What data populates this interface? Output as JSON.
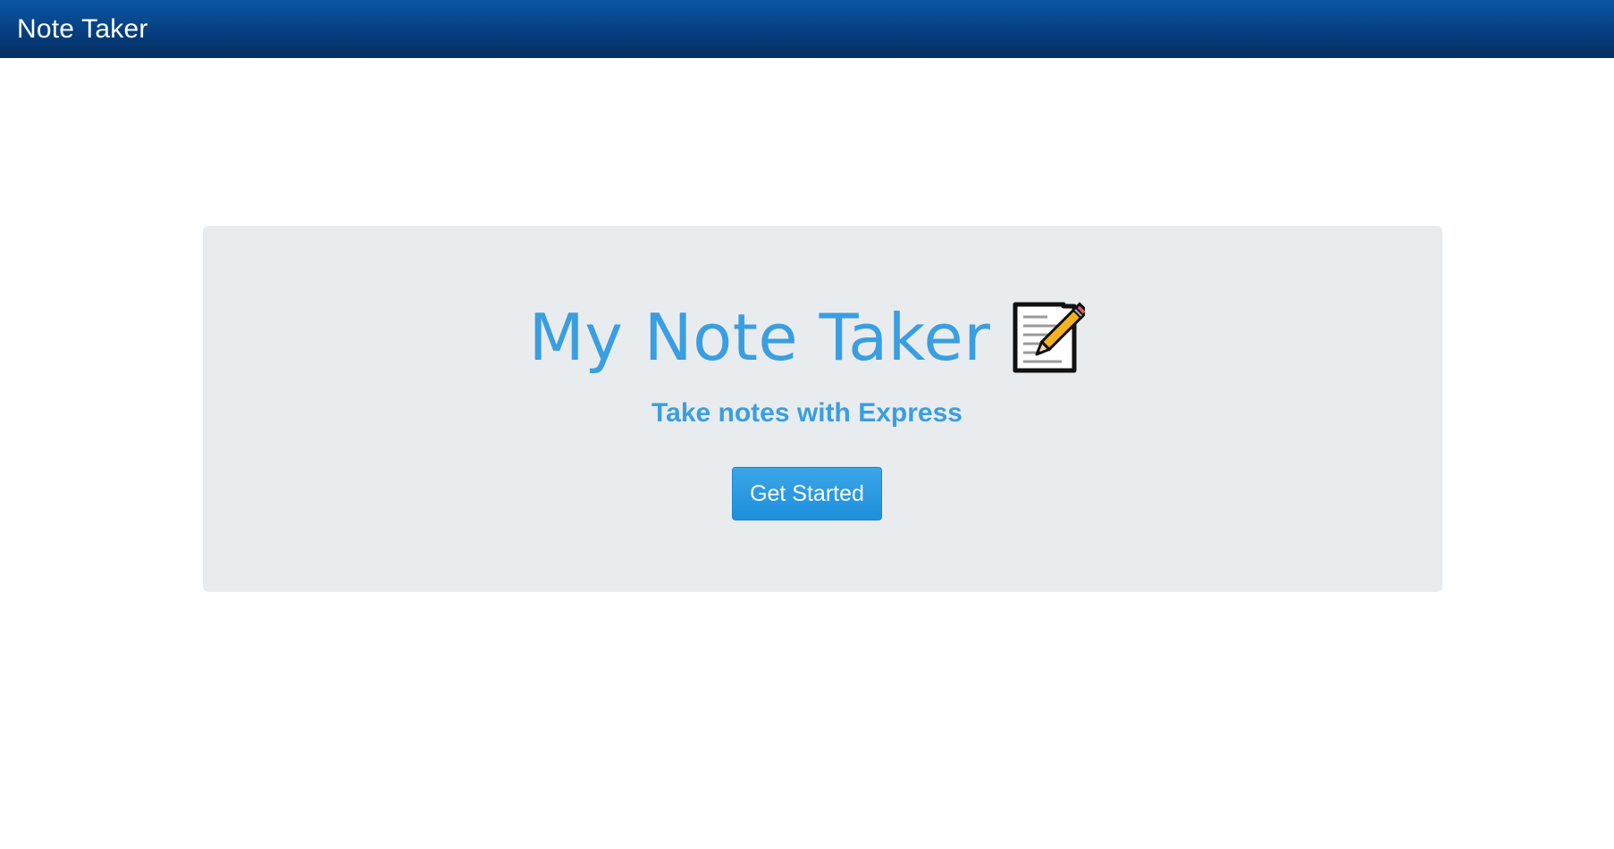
{
  "navbar": {
    "brand": "Note Taker"
  },
  "hero": {
    "title": "My Note Taker",
    "icon": "memo-icon",
    "subtitle": "Take notes with Express",
    "cta_label": "Get Started"
  },
  "colors": {
    "navbar_top": "#0a56a5",
    "navbar_bottom": "#052f60",
    "accent": "#3a9ee0",
    "jumbotron_bg": "#e8ecef",
    "button_bg": "#2a9ae2"
  }
}
